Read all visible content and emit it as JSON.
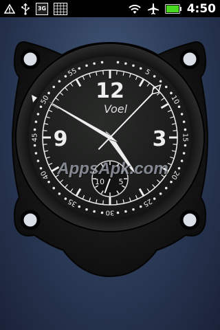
{
  "status_bar": {
    "time": "4:50",
    "left_icons": [
      "warning-icon",
      "usb-icon",
      "3g-icon",
      "grid-icon"
    ],
    "network_label": "3G",
    "right_icons": [
      "wifi-icon",
      "airplane-icon",
      "battery-icon"
    ]
  },
  "clock_widget": {
    "brand": "Voel",
    "hour_numerals": [
      "12",
      "3",
      "9"
    ],
    "minute_labels": [
      "5",
      "10",
      "15",
      "20",
      "25",
      "30",
      "35",
      "40",
      "45",
      "50",
      "55"
    ],
    "sub_dial_labels": [
      "10",
      "5"
    ],
    "time_shown": {
      "hour": 4,
      "minute": 50,
      "second": 4
    },
    "watermark": "AppsApk.com",
    "colors": {
      "dial": "#1b1d1b",
      "case": "#121212",
      "markings": "#eeeeee"
    }
  }
}
